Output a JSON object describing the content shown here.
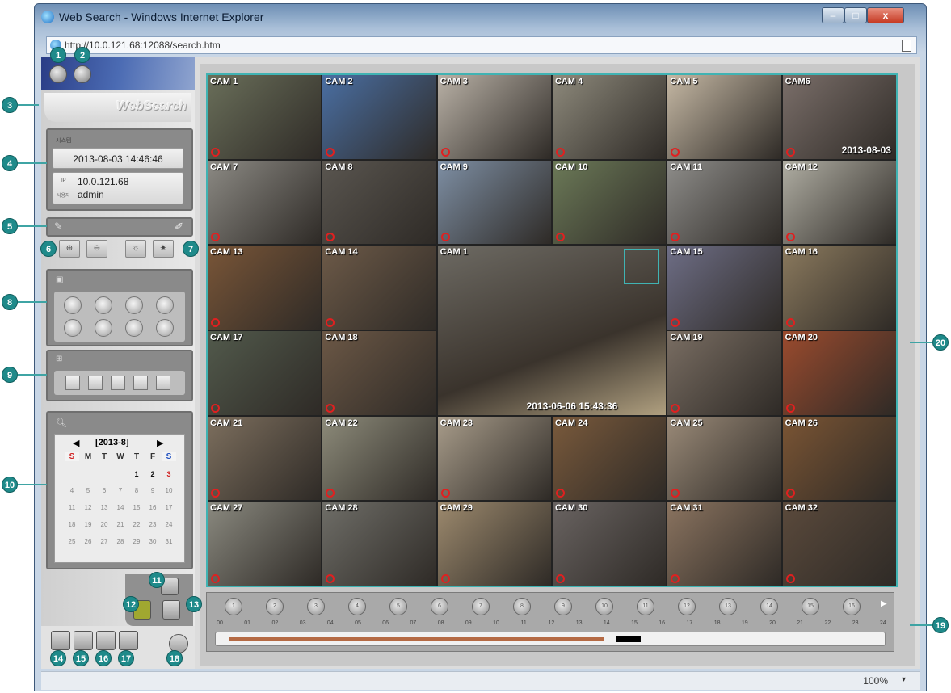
{
  "window": {
    "title": "Web Search - Windows Internet Explorer",
    "url": "http://10.0.121.68:12088/search.htm"
  },
  "app": {
    "banner": "WebSearch"
  },
  "info": {
    "datetime_label": "시스템",
    "datetime": "2013-08-03 14:46:46",
    "ip_label": "IP",
    "ip": "10.0.121.68",
    "user_label": "사용자",
    "user": "admin"
  },
  "cameras": [
    {
      "label": "CAM 1",
      "color": "#6a6f5a"
    },
    {
      "label": "CAM 2",
      "color": "#4a6fa3"
    },
    {
      "label": "CAM 3",
      "color": "#b9b1a6"
    },
    {
      "label": "CAM 4",
      "color": "#8e8a7c"
    },
    {
      "label": "CAM 5",
      "color": "#c5b8a4"
    },
    {
      "label": "CAM6",
      "color": "#7b6f6a",
      "timestamp": "2013-08-03"
    },
    {
      "label": "CAM 7",
      "color": "#8c8a84"
    },
    {
      "label": "CAM 8",
      "color": "#5a5650"
    },
    {
      "label": "CAM 9",
      "color": "#7e8fa4"
    },
    {
      "label": "CAM 10",
      "color": "#6c7a58"
    },
    {
      "label": "CAM 11",
      "color": "#8e8d8a"
    },
    {
      "label": "CAM 12",
      "color": "#b0aea3"
    },
    {
      "label": "CAM 13",
      "color": "#7a5638"
    },
    {
      "label": "CAM 14",
      "color": "#6d5a48"
    },
    {
      "label": "CAM 15",
      "color": "#6e6e86"
    },
    {
      "label": "CAM 16",
      "color": "#8b7a5e"
    },
    {
      "label": "CAM 17",
      "color": "#525a4c"
    },
    {
      "label": "CAM 18",
      "color": "#6c5846"
    },
    {
      "label": "CAM 19",
      "color": "#7a6e63"
    },
    {
      "label": "CAM 20",
      "color": "#9b4b2e"
    },
    {
      "label": "CAM 21",
      "color": "#7d6f5e"
    },
    {
      "label": "CAM 22",
      "color": "#8d8b7a"
    },
    {
      "label": "CAM 23",
      "color": "#a89c8a"
    },
    {
      "label": "CAM 24",
      "color": "#7a5a3c"
    },
    {
      "label": "CAM 25",
      "color": "#9a8a78"
    },
    {
      "label": "CAM 26",
      "color": "#7b5534"
    },
    {
      "label": "CAM 27",
      "color": "#8b8a80"
    },
    {
      "label": "CAM 28",
      "color": "#6f6e68"
    },
    {
      "label": "CAM 29",
      "color": "#9d8a6e"
    },
    {
      "label": "CAM 30",
      "color": "#6a6462"
    },
    {
      "label": "CAM 31",
      "color": "#8b7460"
    },
    {
      "label": "CAM 32",
      "color": "#5b4a3c"
    }
  ],
  "big_cam": {
    "label": "CAM 1",
    "timestamp": "2013-06-06 15:43:36",
    "color": "#6d6a63"
  },
  "calendar": {
    "month": "[2013-8]",
    "weekdays": [
      "S",
      "M",
      "T",
      "W",
      "T",
      "F",
      "S"
    ],
    "weeks": [
      [
        "",
        "",
        "",
        "",
        "1",
        "2",
        "3"
      ],
      [
        "4",
        "5",
        "6",
        "7",
        "8",
        "9",
        "10"
      ],
      [
        "11",
        "12",
        "13",
        "14",
        "15",
        "16",
        "17"
      ],
      [
        "18",
        "19",
        "20",
        "21",
        "22",
        "23",
        "24"
      ],
      [
        "25",
        "26",
        "27",
        "28",
        "29",
        "30",
        "31"
      ]
    ]
  },
  "timeline": {
    "channels": [
      "1",
      "2",
      "3",
      "4",
      "5",
      "6",
      "7",
      "8",
      "9",
      "10",
      "11",
      "12",
      "13",
      "14",
      "15",
      "16"
    ],
    "hours": [
      "00",
      "01",
      "02",
      "03",
      "04",
      "05",
      "06",
      "07",
      "08",
      "09",
      "10",
      "11",
      "12",
      "13",
      "14",
      "15",
      "16",
      "17",
      "18",
      "19",
      "20",
      "21",
      "22",
      "23",
      "24"
    ],
    "recorded_fraction": 0.58,
    "cursor_fraction": 0.6
  },
  "status": {
    "zoom": "100%"
  },
  "callouts": [
    "1",
    "2",
    "3",
    "4",
    "5",
    "6",
    "7",
    "8",
    "9",
    "10",
    "11",
    "12",
    "13",
    "14",
    "15",
    "16",
    "17",
    "18",
    "19",
    "20"
  ],
  "colors": {
    "callout": "#1f8a8a",
    "highlight": "#40b3b3",
    "sidebar_header": "#2a3d86"
  }
}
